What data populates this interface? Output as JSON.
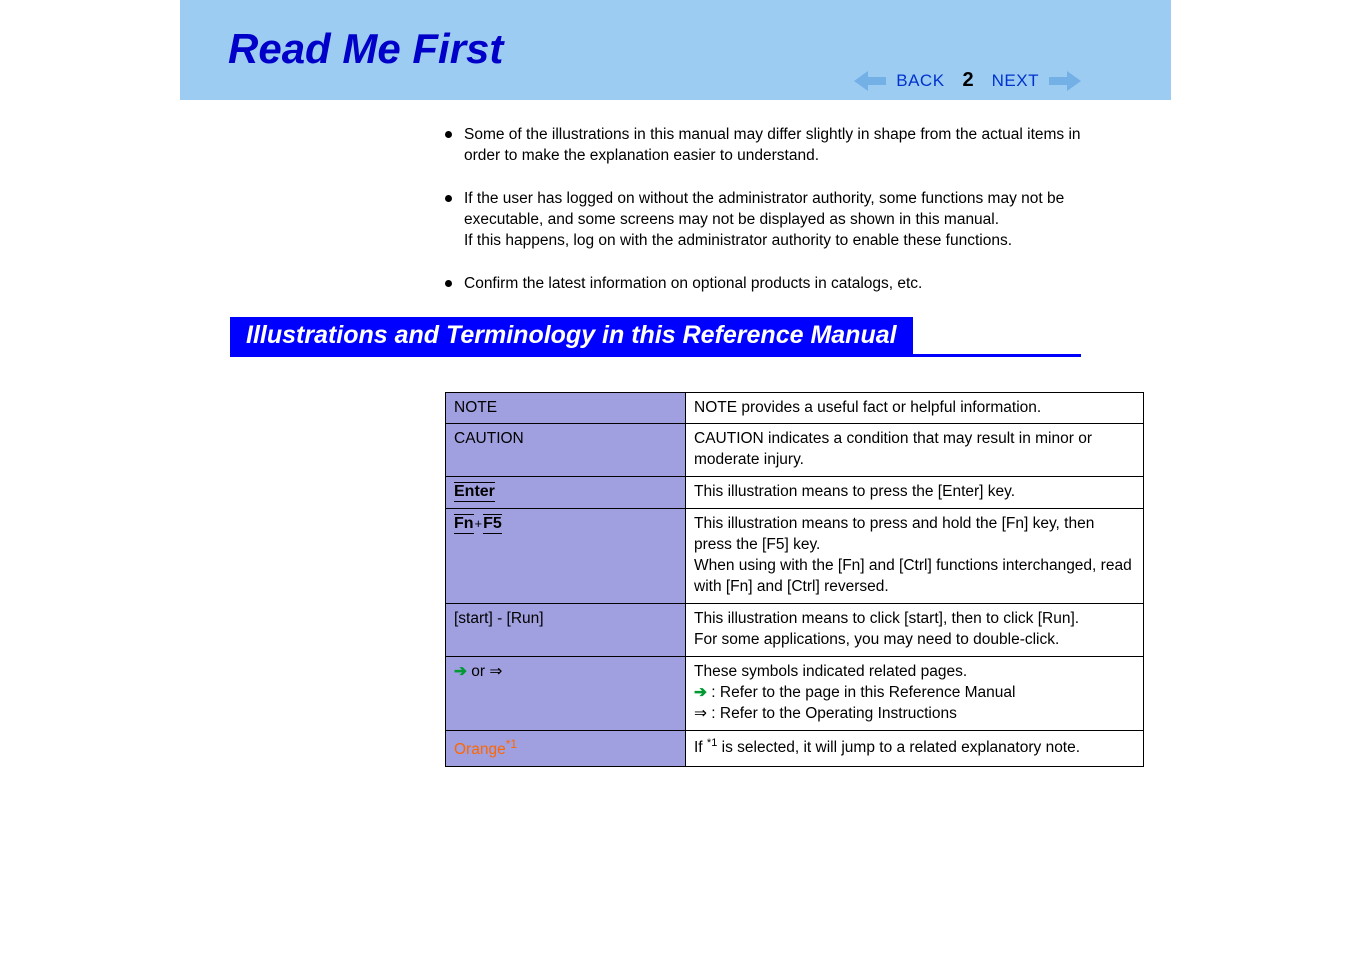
{
  "header": {
    "title": "Read Me First",
    "back_label": "BACK",
    "next_label": "NEXT",
    "page_number": "2"
  },
  "bullets": [
    {
      "text": "Some of the illustrations in this manual may differ slightly in shape from the actual items in order to make the explanation easier to understand."
    },
    {
      "text1": "If the user has logged on without the administrator authority, some functions may not be executable, and some screens may not be displayed as shown in this manual.",
      "text2": "If this happens, log on with the administrator authority to enable these functions."
    },
    {
      "text": "Confirm the latest information on optional products in catalogs, etc."
    }
  ],
  "section": {
    "heading": "Illustrations and Terminology in this Reference Manual"
  },
  "table": {
    "rows": [
      {
        "label": "NOTE",
        "label_type": "plain",
        "desc": "NOTE provides a useful fact or helpful information."
      },
      {
        "label": "CAUTION",
        "label_type": "plain",
        "desc": "CAUTION indicates a condition that may result in minor or moderate injury."
      },
      {
        "label": "Enter",
        "label_type": "key",
        "desc": "This illustration means to press the [Enter] key."
      },
      {
        "label_fn": "Fn",
        "label_plus": "+",
        "label_f5": "F5",
        "label_type": "fnkey",
        "desc1": "This illustration means to press and hold the [Fn] key, then press the [F5] key.",
        "desc2": "When using with the [Fn] and [Ctrl] functions interchanged, read with [Fn] and [Ctrl] reversed."
      },
      {
        "label": "[start] - [Run]",
        "label_type": "plain",
        "desc1": "This illustration means to click [start], then to click [Run].",
        "desc2": "For some applications, you may need to double-click."
      },
      {
        "label_arrow": "➔",
        "label_or": " or ",
        "label_darrow": "⇒",
        "label_type": "arrows",
        "desc1": "These symbols indicated related pages.",
        "desc2_arrow": "➔",
        "desc2_text": " : Refer to the page in this Reference Manual",
        "desc3_arrow": "⇒",
        "desc3_text": " : Refer to the Operating Instructions"
      },
      {
        "label_text": "Orange",
        "label_sup": "*1",
        "label_type": "orange",
        "desc_pre": "If ",
        "desc_sup": "*1",
        "desc_post": " is selected, it will jump to a related explanatory note."
      }
    ]
  }
}
